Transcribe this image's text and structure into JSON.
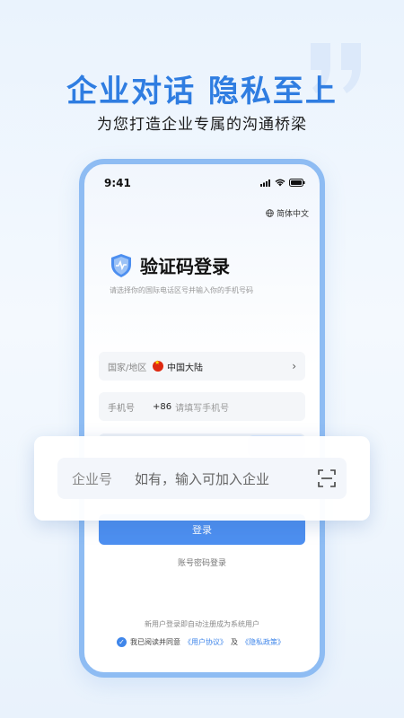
{
  "promo": {
    "headline": "企业对话 隐私至上",
    "subheadline": "为您打造企业专属的沟通桥梁"
  },
  "status_bar": {
    "time": "9:41"
  },
  "language": {
    "label": "简体中文",
    "icon": "globe-icon"
  },
  "login": {
    "title": "验证码登录",
    "hint": "请选择你的国际电话区号并输入你的手机号码",
    "country": {
      "label": "国家/地区",
      "value": "中国大陆"
    },
    "phone": {
      "label": "手机号",
      "prefix": "+86",
      "placeholder": "请填写手机号"
    },
    "company": {
      "label": "企业号",
      "placeholder": "如有，输入可加入企业"
    },
    "login_button": "登录",
    "password_login": "账号密码登录",
    "register_note": "新用户登录即自动注册成为系统用户",
    "agreement": {
      "prefix": "我已阅读并同意",
      "user_agreement": "《用户协议》",
      "conjunction": "及",
      "privacy_policy": "《隐私政策》"
    }
  },
  "colors": {
    "accent": "#2f7de1",
    "button": "#4d8ff0",
    "frame": "#8ebcf3"
  }
}
